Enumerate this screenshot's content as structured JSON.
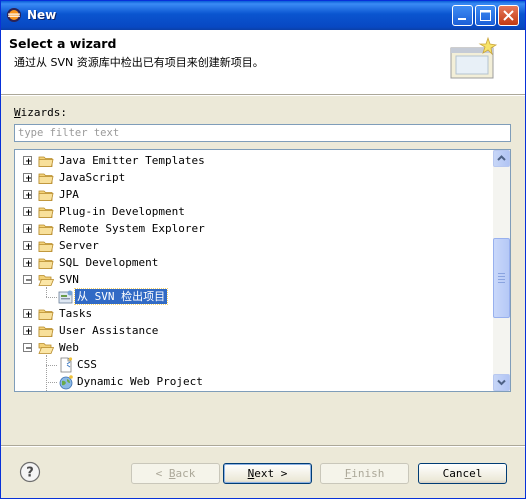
{
  "window": {
    "title": "New"
  },
  "header": {
    "title": "Select a wizard",
    "description": "通过从 SVN 资源库中检出已有项目来创建新项目。"
  },
  "wizards_label": {
    "accel": "W",
    "rest": "izards:"
  },
  "filter": {
    "placeholder": "type filter text",
    "value": ""
  },
  "tree": {
    "items": [
      {
        "label": "Java Emitter Templates",
        "expanded": false
      },
      {
        "label": "JavaScript",
        "expanded": false
      },
      {
        "label": "JPA",
        "expanded": false
      },
      {
        "label": "Plug-in Development",
        "expanded": false
      },
      {
        "label": "Remote System Explorer",
        "expanded": false
      },
      {
        "label": "Server",
        "expanded": false
      },
      {
        "label": "SQL Development",
        "expanded": false
      },
      {
        "label": "SVN",
        "expanded": true
      },
      {
        "label": "从 SVN 检出项目",
        "child": true,
        "selected": true
      },
      {
        "label": "Tasks",
        "expanded": false
      },
      {
        "label": "User Assistance",
        "expanded": false
      },
      {
        "label": "Web",
        "expanded": true
      },
      {
        "label": "CSS",
        "child": true
      },
      {
        "label": "Dynamic Web Project",
        "child": true
      }
    ]
  },
  "buttons": {
    "back": {
      "accel": "B",
      "rest": "ack",
      "prefix": "< "
    },
    "next": {
      "accel": "N",
      "rest": "ext",
      "suffix": " >"
    },
    "finish": {
      "accel": "F",
      "rest": "inish"
    },
    "cancel": "Cancel"
  }
}
